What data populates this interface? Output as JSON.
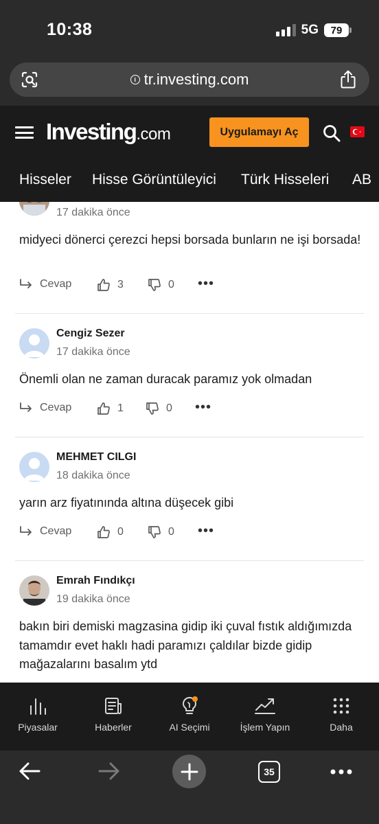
{
  "status_bar": {
    "time": "10:38",
    "network": "5G",
    "battery": "79"
  },
  "browser": {
    "url": "tr.investing.com",
    "tab_count": "35"
  },
  "site_header": {
    "logo_main": "Investing",
    "logo_suffix": ".com",
    "open_app_label": "Uygulamayı Aç"
  },
  "nav": {
    "items": [
      {
        "label": "Hisseler"
      },
      {
        "label": "Hisse Görüntüleyici"
      },
      {
        "label": "Türk Hisseleri"
      },
      {
        "label": "AB"
      }
    ]
  },
  "comments": [
    {
      "author": "",
      "time": "17 dakika önce",
      "text": "midyeci dönerci çerezci hepsi borsada bunların ne işi borsada!",
      "reply_label": "Cevap",
      "likes": "3",
      "dislikes": "0"
    },
    {
      "author": "Cengiz Sezer",
      "time": "17 dakika önce",
      "text": "Önemli olan ne zaman duracak paramız yok olmadan",
      "reply_label": "Cevap",
      "likes": "1",
      "dislikes": "0"
    },
    {
      "author": "MEHMET CILGI",
      "time": "18 dakika önce",
      "text": "yarın arz fiyatınında altına düşecek gibi",
      "reply_label": "Cevap",
      "likes": "0",
      "dislikes": "0"
    },
    {
      "author": "Emrah Fındıkçı",
      "time": "19 dakika önce",
      "text": "bakın biri demiski magzasina gidip iki çuval fıstık aldığımızda tamamdır evet haklı hadi paramızı çaldılar bizde gidip mağazalarını basalım ytd",
      "reply_label": "",
      "likes": "",
      "dislikes": ""
    }
  ],
  "bottom_nav": {
    "items": [
      {
        "label": "Piyasalar",
        "icon": "bar-chart-icon"
      },
      {
        "label": "Haberler",
        "icon": "news-icon"
      },
      {
        "label": "AI Seçimi",
        "icon": "lightbulb-icon"
      },
      {
        "label": "İşlem Yapın",
        "icon": "trend-icon"
      },
      {
        "label": "Daha",
        "icon": "grid-dots-icon"
      }
    ]
  },
  "colors": {
    "accent_orange": "#f7931e",
    "header_bg": "#1b1b1b",
    "chrome_bg": "#2b2b2b",
    "notification_dot": "#f7931e",
    "flag_red": "#e30a17"
  }
}
